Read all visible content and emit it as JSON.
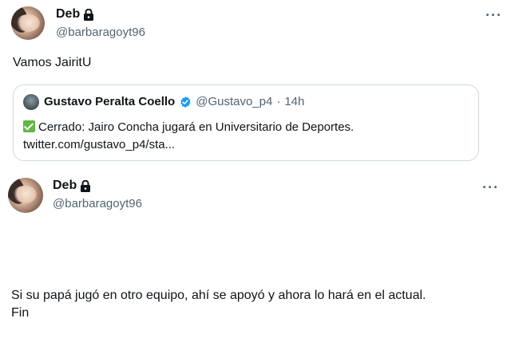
{
  "tweets": [
    {
      "display_name": "Deb",
      "handle": "@barbaragoyt96",
      "text": "Vamos JairitU",
      "more_label": "···",
      "quote": {
        "display_name": "Gustavo Peralta Coello",
        "handle": "@Gustavo_p4",
        "separator": "·",
        "time": "14h",
        "text": "Cerrado: Jairo Concha jugará en Universitario de Deportes.",
        "link": "twitter.com/gustavo_p4/sta..."
      }
    },
    {
      "display_name": "Deb",
      "handle": "@barbaragoyt96",
      "text_line1": "Si su papá jugó en otro equipo, ahí se apoyó y ahora lo hará en el actual.",
      "text_line2": "Fin",
      "more_label": "···"
    }
  ],
  "colors": {
    "text": "#0f1419",
    "secondary": "#536471",
    "border": "#cfd9de",
    "verified": "#1d9bf0",
    "check": "#5fb844"
  },
  "icons": [
    "lock-icon",
    "verified-badge-icon",
    "check-mark-icon",
    "more-options-icon"
  ]
}
